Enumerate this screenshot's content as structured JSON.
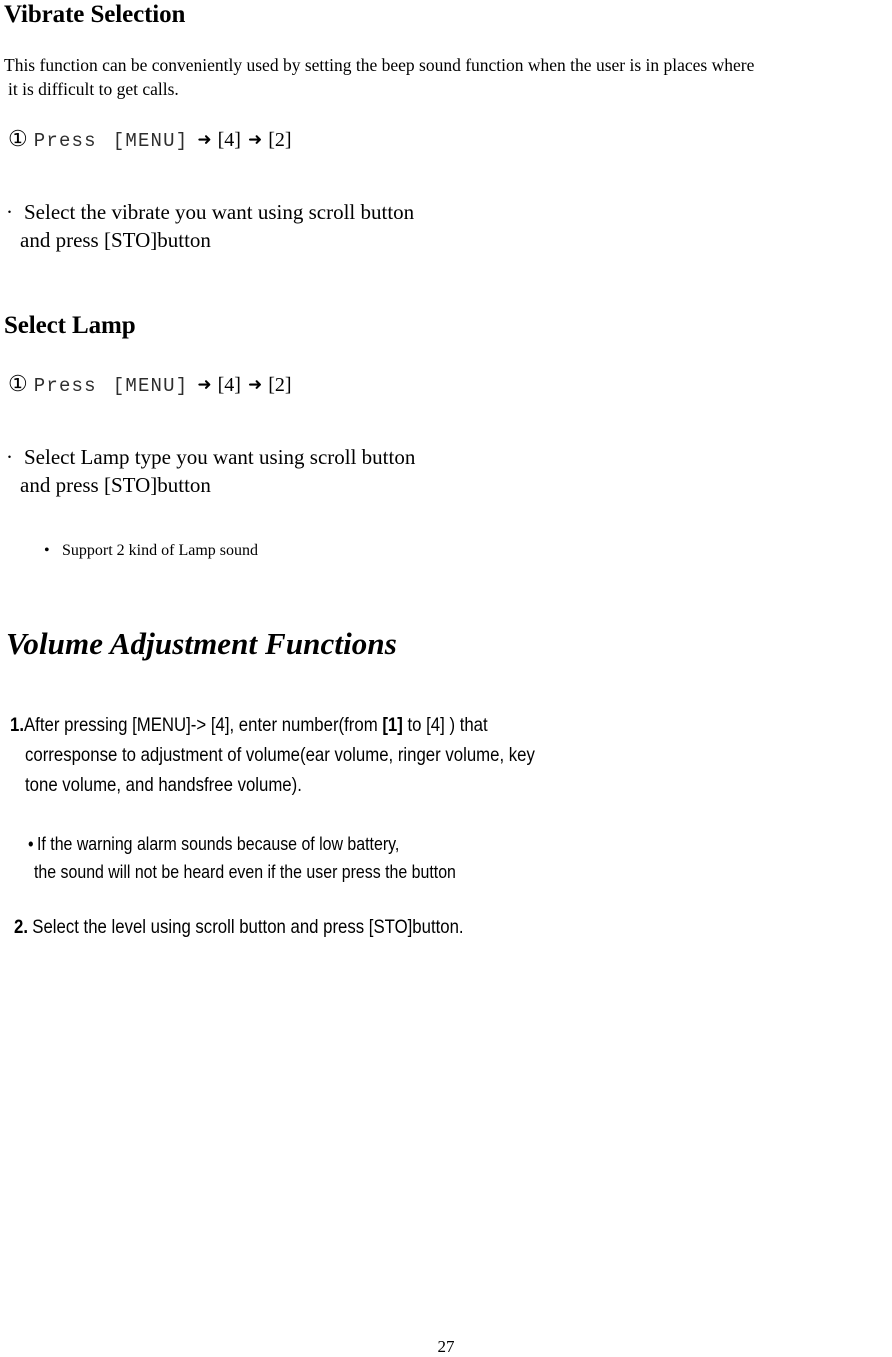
{
  "document": {
    "page_number": "27"
  },
  "sections": {
    "vibrate": {
      "heading": "Vibrate Selection",
      "intro_line1": "This function can be conveniently used by setting the beep sound function when the user is in places where",
      "intro_line2": "it is difficult to get calls.",
      "step": {
        "circled_number": "①",
        "press_label": "Press",
        "key_menu": "[MENU]",
        "arrow": "➜",
        "key_4": "[4]",
        "key_2": "[2]"
      },
      "bullet": {
        "marker": "·",
        "line1": "Select the vibrate you want using scroll button",
        "line2": "and press [STO]button"
      }
    },
    "lamp": {
      "heading": "Select Lamp",
      "step": {
        "circled_number": "①",
        "press_label": "Press",
        "key_menu": "[MENU]",
        "arrow": "➜",
        "key_4": "[4]",
        "key_2": "[2]"
      },
      "bullet": {
        "marker": "·",
        "line1": "Select Lamp type you want using scroll button",
        "line2": "and press [STO]button"
      },
      "note": {
        "marker": "•",
        "text": "Support 2 kind of Lamp sound"
      }
    },
    "volume": {
      "heading": "Volume Adjustment Functions",
      "item1": {
        "number": "1.",
        "line1_a": "After pressing [MENU]-> [4], enter number(from ",
        "line1_bold": "[1]",
        "line1_b": " to [4] ) that",
        "line2": "corresponse to adjustment of volume(ear volume, ringer volume, key",
        "line3": "tone volume, and handsfree volume)."
      },
      "note": {
        "marker": "•",
        "line1": "If the warning alarm sounds because of low battery,",
        "line2": "the sound will not be heard even if the user press the button"
      },
      "item2": {
        "number": "2.",
        "text": "Select the level using scroll button and press [STO]button."
      }
    }
  }
}
